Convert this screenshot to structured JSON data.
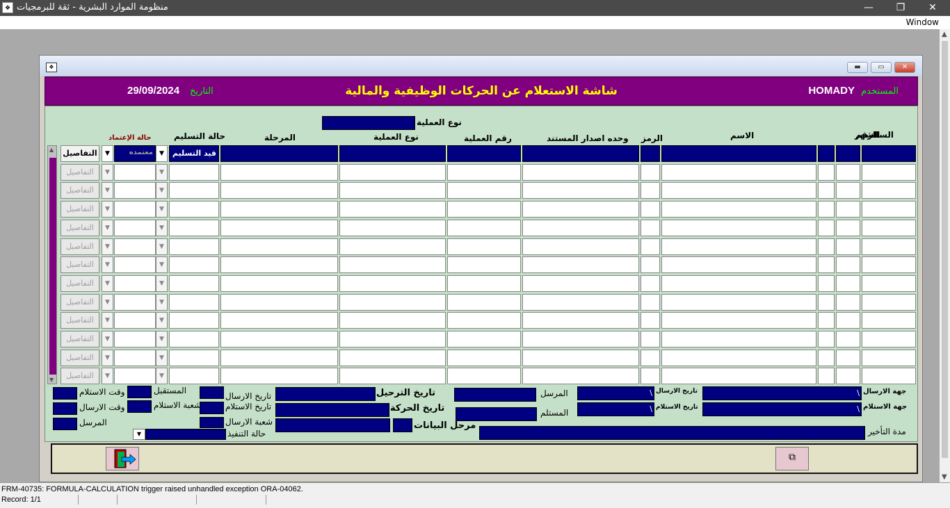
{
  "os": {
    "app_title": "منظومة الموارد البشرية - ثقة للبرمجيات",
    "menu_window": "Window",
    "minimize_glyph": "—",
    "maximize_glyph": "❐",
    "close_glyph": "✕"
  },
  "header": {
    "title": "شاشة الاستعلام عن الحركات الوظيفية والمالية",
    "user_label": "المستخدم",
    "user": "HOMADY",
    "date_label": "التاريخ",
    "date": "29/09/2024"
  },
  "filter": {
    "op_type_label": "نوع العملية"
  },
  "columns": {
    "number": "الرقم",
    "month": "الشهر",
    "year": "السنة",
    "name": "الاسم",
    "code": "الرمز",
    "issue_unit": "وحده اصدار المستند",
    "op_number": "رقم العملية",
    "op_type": "نوع العملية",
    "stage": "المرحلة",
    "delivery_status": "حالة التسليم",
    "approval_status": "حالة الإعتماد"
  },
  "rows": {
    "first_delivery": "قيد التسليم",
    "first_approval": "معتمده",
    "details_label": "التفاصيل"
  },
  "bottom": {
    "send_party": "جهة الارسال",
    "receive_party": "جهة الاستلام",
    "delay": "مدة التأخير",
    "send_date_small": "تاريخ الارسال",
    "receive_date_small": "تاريخ الاستلام",
    "sender": "المرسل",
    "receiver": "المستلم",
    "transfer_date": "تاريخ الترحيل",
    "movement_date": "تاريخ الحركة",
    "data_stage": "مرحل البيانات",
    "send_date": "تاريخ الارسال",
    "receive_date": "تاريخ الاستلام",
    "send_branch": "شعبة الارسال",
    "exec_status": "حالة التنفيذ",
    "recipient": "المستقبل",
    "receive_branch": "شعبة الاستلام",
    "receive_time": "وقت الاستلام",
    "send_time": "وقت الارسال",
    "sender2": "المرسل",
    "slash1": "\\",
    "slash2": "\\",
    "slash3": "\\",
    "slash4": "\\"
  },
  "status": {
    "message": "FRM-40735: FORMULA-CALCULATION trigger raised unhandled exception ORA-04062.",
    "record": "Record: 1/1"
  },
  "colors": {
    "header_bg": "#800080",
    "title_yellow": "#ffff00",
    "label_green": "#00ff00",
    "field_navy": "#000080",
    "panel_green": "#c5e0c8"
  }
}
